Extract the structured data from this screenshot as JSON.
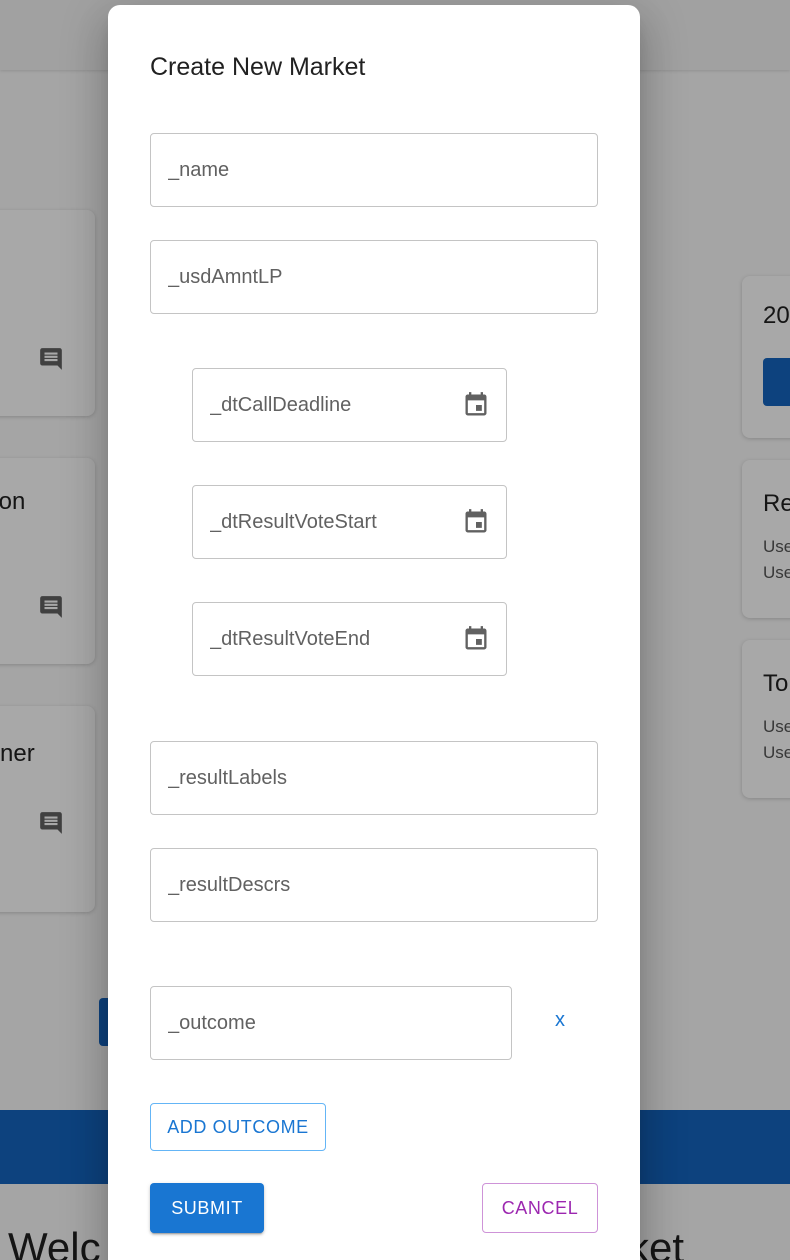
{
  "background": {
    "left_cards": [
      {
        "title": ""
      },
      {
        "title": "pion"
      },
      {
        "title": "ner"
      }
    ],
    "right_cards": [
      {
        "title": "20",
        "lines": []
      },
      {
        "title": "Re",
        "lines": [
          "Use",
          "Use"
        ]
      },
      {
        "title": "To",
        "lines": [
          "Use",
          "Use"
        ]
      }
    ],
    "welcome_left": "Welc",
    "welcome_right": "ket"
  },
  "dialog": {
    "title": "Create New Market",
    "fields": {
      "name": {
        "placeholder": "_name",
        "value": ""
      },
      "usd_amount_lp": {
        "placeholder": "_usdAmntLP",
        "value": ""
      },
      "call_deadline": {
        "placeholder": "_dtCallDeadline",
        "value": ""
      },
      "result_vote_start": {
        "placeholder": "_dtResultVoteStart",
        "value": ""
      },
      "result_vote_end": {
        "placeholder": "_dtResultVoteEnd",
        "value": ""
      },
      "result_labels": {
        "placeholder": "_resultLabels",
        "value": ""
      },
      "result_descrs": {
        "placeholder": "_resultDescrs",
        "value": ""
      },
      "outcome": {
        "placeholder": "_outcome",
        "value": ""
      }
    },
    "remove_outcome_label": "x",
    "add_outcome_label": "ADD OUTCOME",
    "submit_label": "SUBMIT",
    "cancel_label": "CANCEL"
  },
  "colors": {
    "primary": "#1976d2",
    "secondary": "#9c27b0",
    "band": "#1565c0"
  },
  "icons": {
    "date_picker": "calendar-icon",
    "card_action": "comment-icon"
  }
}
